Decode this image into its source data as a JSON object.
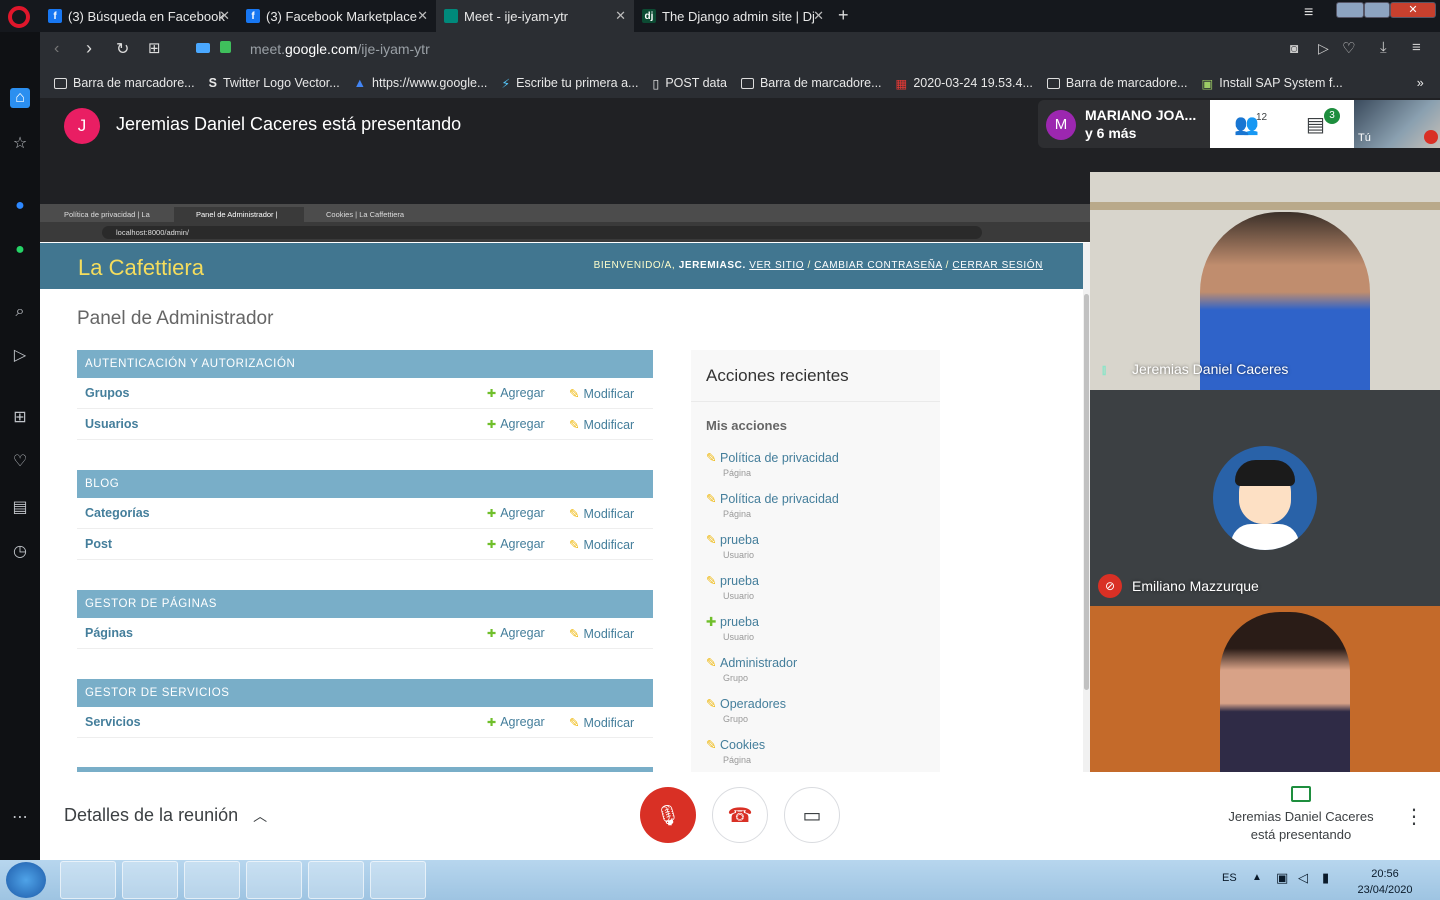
{
  "browser_tabs": [
    {
      "label": "(3) Búsqueda en Facebook",
      "icon": "facebook-icon",
      "color": "#1877f2"
    },
    {
      "label": "(3) Facebook Marketplace",
      "icon": "facebook-icon",
      "color": "#1877f2"
    },
    {
      "label": "Meet - ije-iyam-ytr",
      "icon": "meet-icon",
      "color": "#00897b"
    },
    {
      "label": "The Django admin site | Dj",
      "icon": "django-icon",
      "color": "#0c4b33"
    }
  ],
  "address": {
    "url_prefix": "meet.",
    "url_domain": "google.com",
    "url_path": "/ije-iyam-ytr"
  },
  "bookmarks": [
    "Barra de marcadore...",
    "Twitter Logo Vector...",
    "https://www.google...",
    "Escribe tu primera a...",
    "POST data",
    "Barra de marcadore...",
    "2020-03-24 19.53.4...",
    "Barra de marcadore...",
    "Install SAP System f..."
  ],
  "meet": {
    "presenter_initial": "J",
    "presenter_text": "Jeremias Daniel Caceres está presentando",
    "participants_name": "MARIANO JOA...",
    "participants_more": "y 6 más",
    "participants_initial": "M",
    "people_count": "12",
    "chat_count": "3",
    "self_label": "Tú",
    "tiles": [
      {
        "name": "Jeremias Daniel Caceres"
      },
      {
        "name": "Emiliano Mazzurque"
      },
      {
        "name": ""
      }
    ],
    "details_label": "Detalles de la reunión",
    "presenting_note": "Jeremias Daniel Caceres está presentando"
  },
  "shared": {
    "tabs": [
      "Política de privacidad | La",
      "Panel de Administrador | ",
      "Cookies | La Caffettiera"
    ],
    "url": "localhost:8000/admin/",
    "brand": "La Cafettiera",
    "welcome": "BIENVENIDO/A,",
    "user": "JEREMIASC.",
    "links": [
      "VER SITIO",
      "CAMBIAR CONTRASEÑA",
      "CERRAR SESIÓN"
    ],
    "title": "Panel de Administrador",
    "add_label": "Agregar",
    "change_label": "Modificar",
    "modules": [
      {
        "caption": "AUTENTICACIÓN Y AUTORIZACIÓN",
        "rows": [
          "Grupos",
          "Usuarios"
        ]
      },
      {
        "caption": "BLOG",
        "rows": [
          "Categorías",
          "Post"
        ]
      },
      {
        "caption": "GESTOR DE PÁGINAS",
        "rows": [
          "Páginas"
        ]
      },
      {
        "caption": "GESTOR DE SERVICIOS",
        "rows": [
          "Servicios"
        ]
      }
    ],
    "recent_title": "Acciones recientes",
    "my_actions": "Mis acciones",
    "actions": [
      {
        "name": "Política de privacidad",
        "type": "Página",
        "kind": "change"
      },
      {
        "name": "Política de privacidad",
        "type": "Página",
        "kind": "change"
      },
      {
        "name": "prueba",
        "type": "Usuario",
        "kind": "change"
      },
      {
        "name": "prueba",
        "type": "Usuario",
        "kind": "change"
      },
      {
        "name": "prueba",
        "type": "Usuario",
        "kind": "add"
      },
      {
        "name": "Administrador",
        "type": "Grupo",
        "kind": "change"
      },
      {
        "name": "Operadores",
        "type": "Grupo",
        "kind": "change"
      },
      {
        "name": "Cookies",
        "type": "Página",
        "kind": "change"
      }
    ]
  },
  "taskbar": {
    "lang": "ES",
    "time": "20:56",
    "date": "23/04/2020"
  }
}
